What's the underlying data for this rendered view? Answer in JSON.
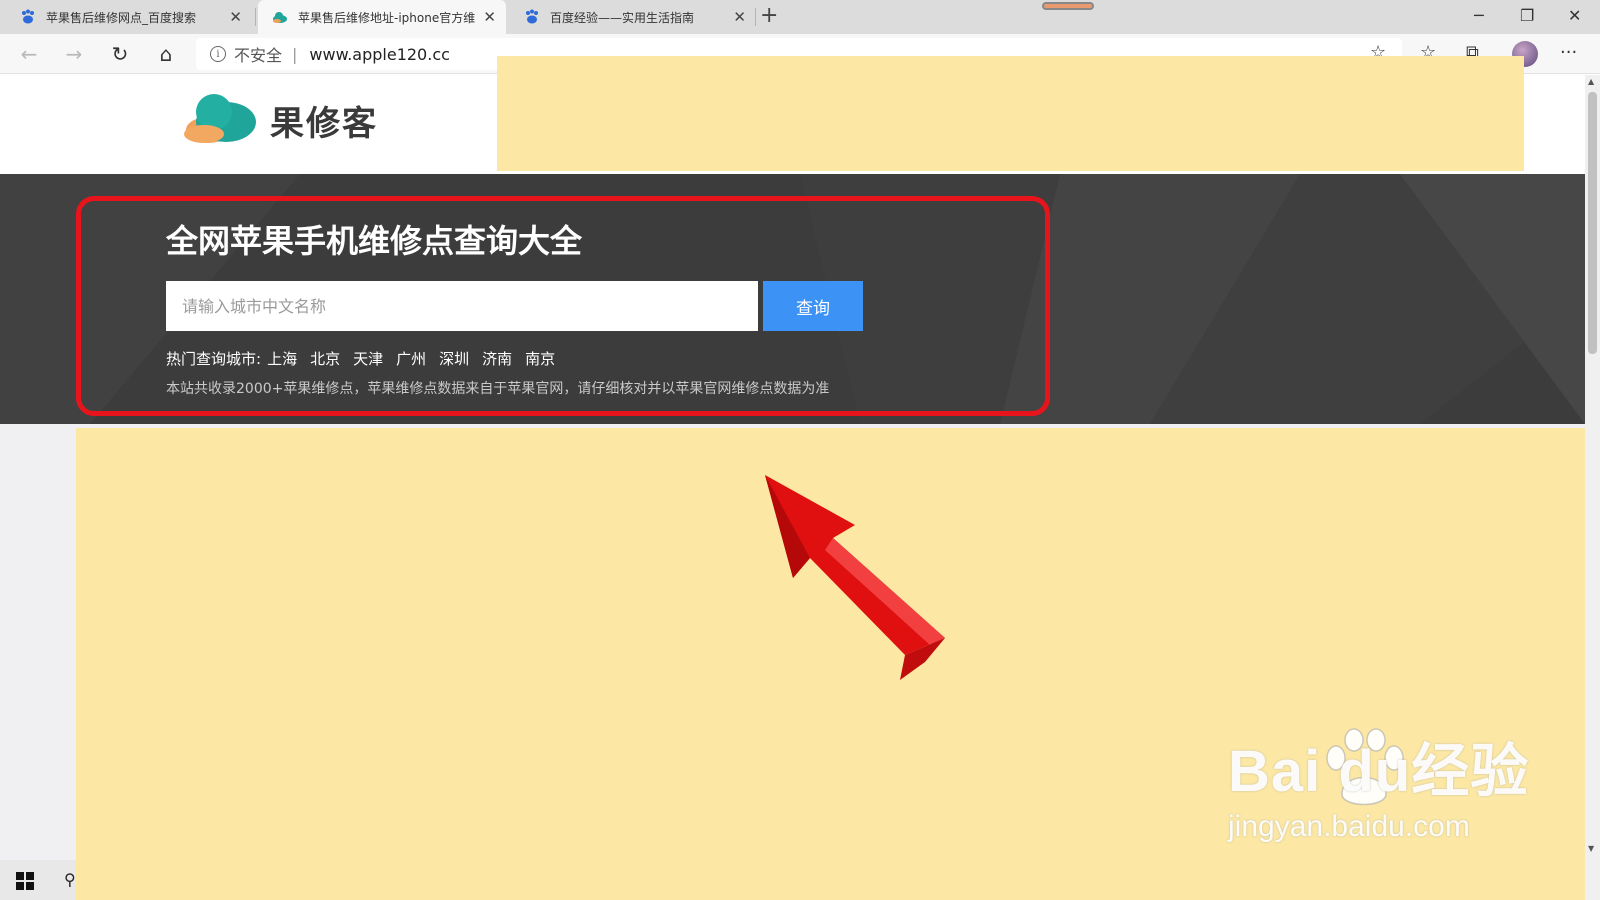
{
  "browser": {
    "tabs": [
      {
        "title": "苹果售后维修网点_百度搜索",
        "icon": "baidu-paw-icon",
        "active": false
      },
      {
        "title": "苹果售后维修地址-iphone官方维",
        "icon": "cloud-logo-icon",
        "active": true
      },
      {
        "title": "百度经验——实用生活指南",
        "icon": "baidu-paw-icon",
        "active": false
      }
    ],
    "new_tab_label": "+",
    "window_controls": {
      "minimize": "─",
      "restore": "❐",
      "close": "✕"
    },
    "nav": {
      "back": "←",
      "forward": "→",
      "refresh": "↻",
      "home": "⌂"
    },
    "address": {
      "security_label": "不安全",
      "separator": "|",
      "url": "www.apple120.cc"
    },
    "toolbar": {
      "favorite": "☆",
      "favorites": "☆",
      "collections": "⧉",
      "more": "···"
    }
  },
  "site": {
    "logo_text": "果修客",
    "hero": {
      "title": "全网苹果手机维修点查询大全",
      "search_placeholder": "请输入城市中文名称",
      "search_button": "查询",
      "hot_label": "热门查询城市:",
      "hot_cities": [
        "上海",
        "北京",
        "天津",
        "广州",
        "深圳",
        "济南",
        "南京"
      ],
      "notice": "本站共收录2000+苹果维修点，苹果维修点数据来自于苹果官网，请仔细核对并以苹果官网维修点数据为准"
    }
  },
  "watermark": {
    "main": "Bai  du经验",
    "sub": "jingyan.baidu.com"
  },
  "colors": {
    "highlight_border": "#e8141c",
    "search_button": "#3d93f5",
    "hero_bg": "#3c3c3c",
    "ad_bg": "#fce8a4",
    "arrow": "#e01010"
  }
}
